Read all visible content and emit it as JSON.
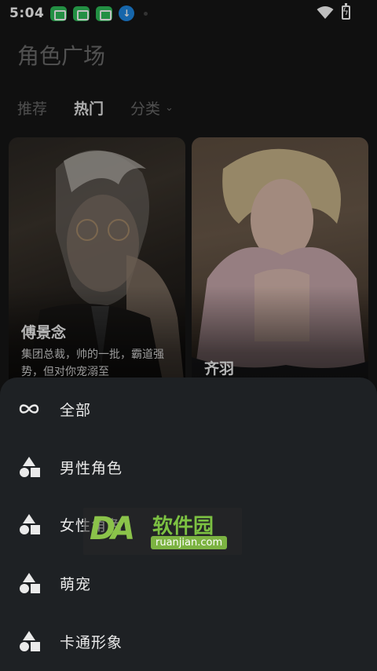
{
  "status_bar": {
    "time": "5:04",
    "icons": [
      "app-icon",
      "app-icon",
      "app-icon",
      "download-icon",
      "dot-icon",
      "wifi-icon",
      "battery-charging-icon"
    ]
  },
  "page": {
    "title": "角色广场"
  },
  "tabs": [
    {
      "label": "推荐"
    },
    {
      "label": "热门"
    },
    {
      "label": "分类"
    }
  ],
  "cards": [
    {
      "name": "傅景念",
      "desc": "集团总裁，帅的一批，霸道强势，但对你宠溺至"
    },
    {
      "name": "齐羽",
      "desc": ""
    }
  ],
  "sheet": {
    "items": [
      {
        "label": "全部",
        "icon": "infinity-icon"
      },
      {
        "label": "男性角色",
        "icon": "shapes-icon"
      },
      {
        "label": "女性角色",
        "icon": "shapes-icon"
      },
      {
        "label": "萌宠",
        "icon": "shapes-icon"
      },
      {
        "label": "卡通形象",
        "icon": "shapes-icon"
      }
    ]
  },
  "watermark": {
    "logo": "DA",
    "cn": "软件园",
    "en": "ruanjian.com"
  },
  "colors": {
    "background": "#161616",
    "sheet": "#1e2124",
    "tab_active": "#e8e8e8",
    "tab_inactive": "#6a6a6a"
  }
}
